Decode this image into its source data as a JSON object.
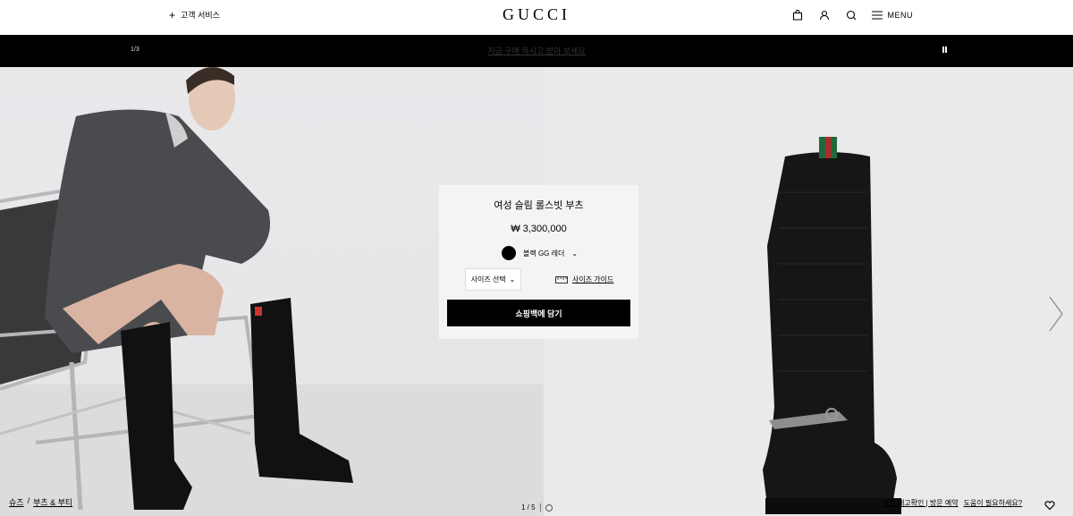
{
  "header": {
    "customer_service": "고객 서비스",
    "customer_service_icon": "plus-icon",
    "logo": "GUCCI",
    "menu_label": "MENU",
    "icons": [
      "shopping-bag-icon",
      "user-icon",
      "search-icon",
      "hamburger-icon"
    ]
  },
  "promo": {
    "counter": "1/3",
    "message": "지금 구매 하시고 받아 보세요",
    "pause_icon": "pause-icon"
  },
  "product": {
    "title": "여성 슬림 롤스빗 부츠",
    "price": "₩ 3,300,000",
    "color": "블랙 GG 레더",
    "color_swatch": "#000000",
    "size_select": "사이즈 선택",
    "size_guide": "사이즈 가이드",
    "add_to_bag": "쇼핑백에 담기"
  },
  "breadcrumb": [
    "슈즈",
    "부츠 & 부티"
  ],
  "gallery": {
    "pager": "1 / 5"
  },
  "store_links": {
    "check_store": "매장 재고확인 | 방문 예약",
    "help": "도움이 필요하세요?"
  },
  "colors": {
    "accent": "#000000",
    "background": "#ffffff",
    "card": "#f4f4f5"
  }
}
